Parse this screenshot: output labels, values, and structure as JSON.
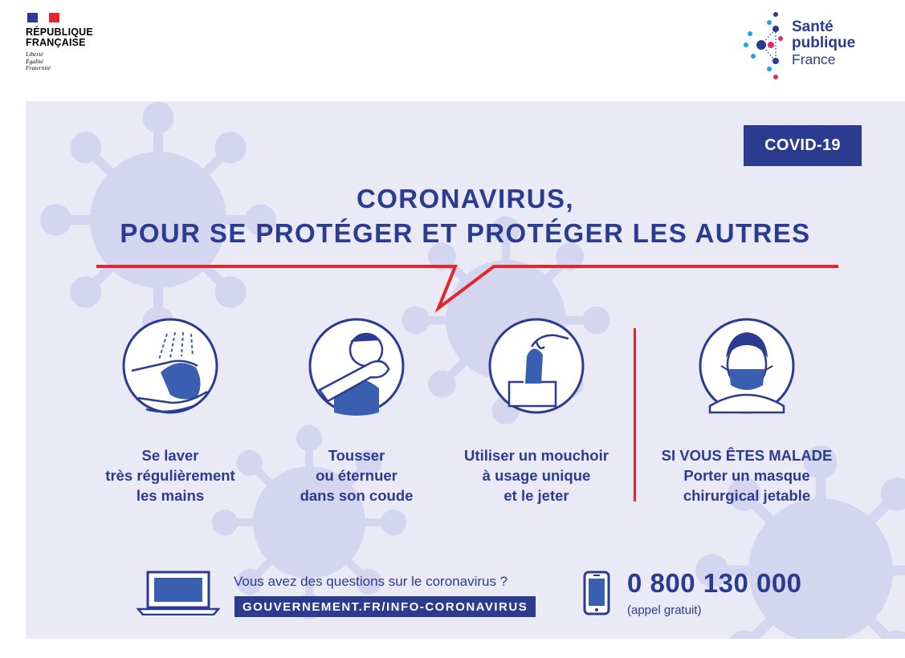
{
  "header": {
    "republique_line1": "RÉPUBLIQUE",
    "republique_line2": "FRANÇAISE",
    "motto": [
      "Liberté",
      "Égalité",
      "Fraternité"
    ],
    "spf_line1": "Santé",
    "spf_line2": "publique",
    "spf_line3": "France"
  },
  "badge": "COVID-19",
  "title": {
    "line1": "CORONAVIRUS,",
    "line2": "POUR SE PROTÉGER ET PROTÉGER LES AUTRES"
  },
  "actions": [
    {
      "icon": "hand-washing-icon",
      "lines": [
        "Se laver",
        "très régulièrement",
        "les mains"
      ]
    },
    {
      "icon": "cough-elbow-icon",
      "lines": [
        "Tousser",
        "ou éternuer",
        "dans son coude"
      ]
    },
    {
      "icon": "tissue-icon",
      "lines": [
        "Utiliser un mouchoir",
        "à usage unique",
        "et le jeter"
      ]
    },
    {
      "icon": "mask-icon",
      "lines": [
        "SI VOUS ÊTES MALADE",
        "Porter un masque",
        "chirurgical jetable"
      ]
    }
  ],
  "footer": {
    "question": "Vous avez des questions sur le coronavirus ?",
    "url": "GOUVERNEMENT.FR/INFO-CORONAVIRUS",
    "phone": "0 800 130 000",
    "phone_note": "(appel gratuit)"
  },
  "colors": {
    "navy": "#2b3b8f",
    "red": "#e2262e",
    "panel": "#e9eaf6",
    "virus": "#d3d6ee",
    "icon_blue": "#3a5fb0"
  }
}
